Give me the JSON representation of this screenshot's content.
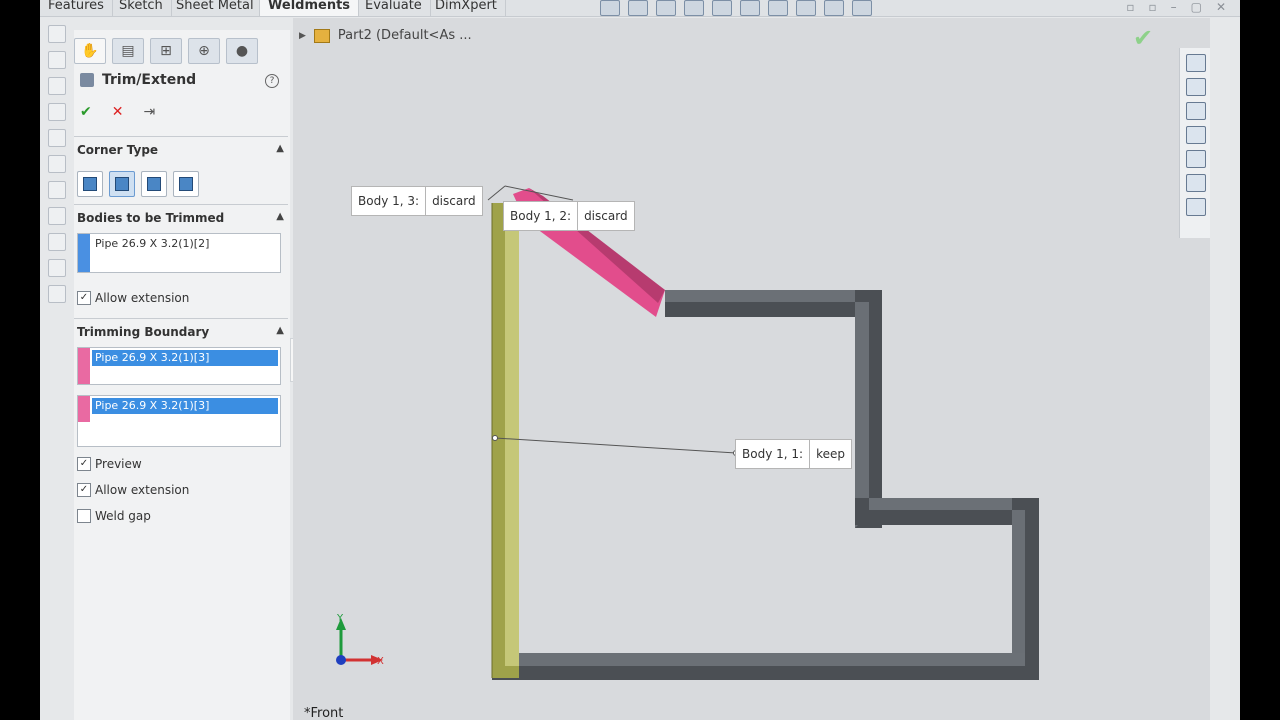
{
  "tabs": [
    "Features",
    "Sketch",
    "Sheet Metal",
    "Weldments",
    "Evaluate",
    "DimXpert"
  ],
  "active_tab": "Weldments",
  "breadcrumb": "Part2  (Default<As ...",
  "property_manager": {
    "title": "Trim/Extend",
    "help": "?",
    "ok": "✔",
    "cancel": "✕",
    "pin": "⇥",
    "corner_type": {
      "label": "Corner Type"
    },
    "bodies_to_trim": {
      "label": "Bodies to be Trimmed",
      "item": "Pipe 26.9 X 3.2(1)[2]",
      "allow_extension": "Allow extension"
    },
    "trimming_boundary": {
      "label": "Trimming Boundary",
      "item1": "Pipe 26.9 X 3.2(1)[3]",
      "item2": "Pipe 26.9 X 3.2(1)[3]",
      "preview": "Preview",
      "allow_extension": "Allow extension",
      "weld_gap": "Weld gap"
    }
  },
  "callouts": {
    "c1": {
      "body": "Body  1,   3:",
      "value": "discard"
    },
    "c2": {
      "body": "Body  1,   2:",
      "value": "discard"
    },
    "c3": {
      "body": "Body  1,   1:",
      "value": "keep"
    }
  },
  "triad": {
    "x": "X",
    "y": "Y"
  },
  "status": "*Front",
  "colors": {
    "accent": "#3b8ee2",
    "trim_body": "#e24d8c",
    "keep_body": "#9fa24a",
    "frame": "#4f5358"
  }
}
